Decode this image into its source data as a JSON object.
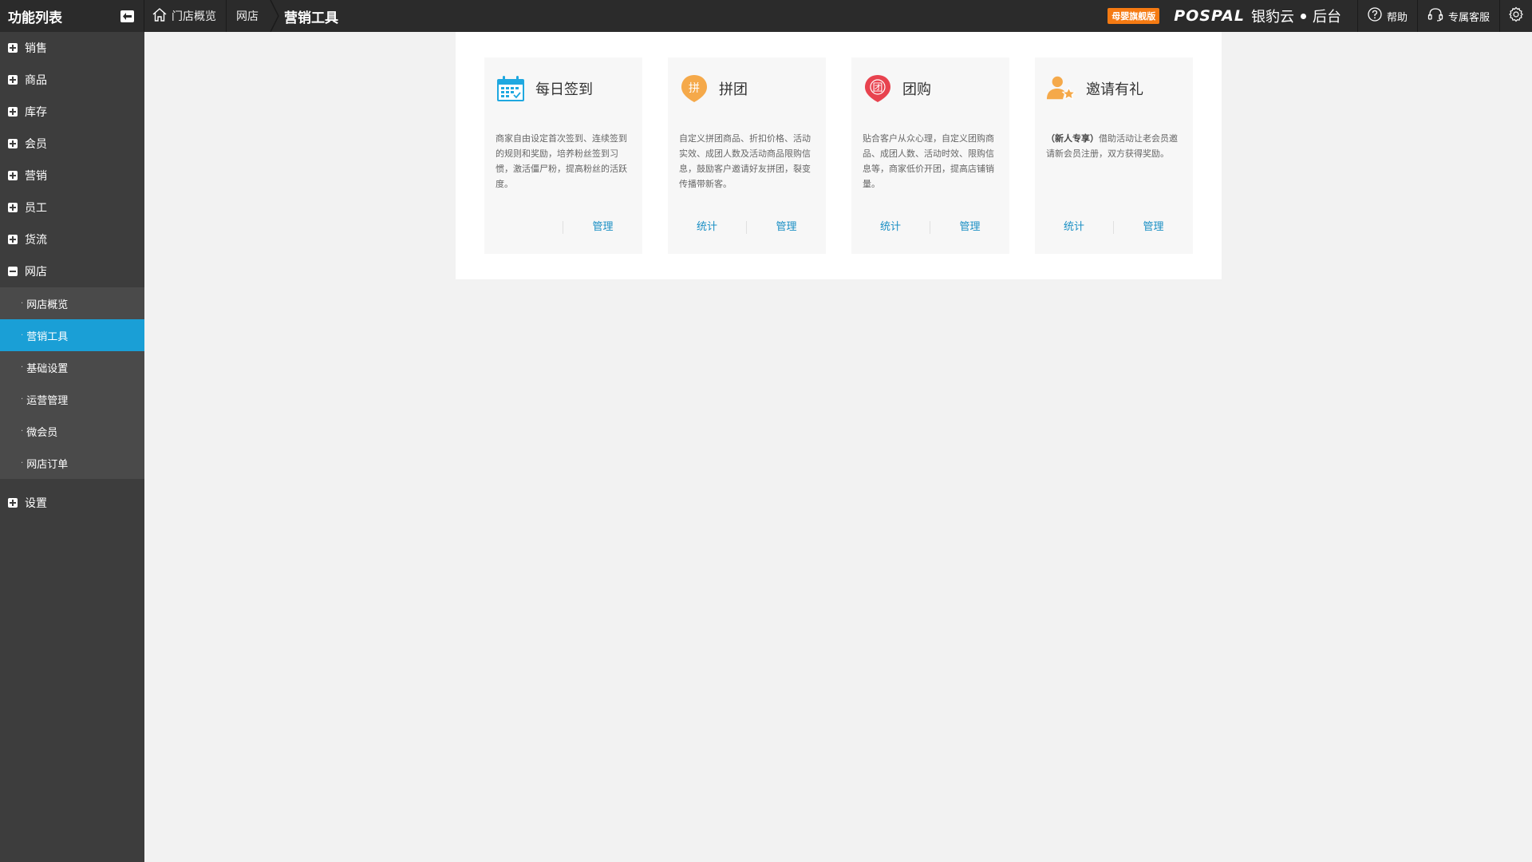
{
  "sidebar": {
    "title": "功能列表",
    "items": [
      {
        "label": "销售"
      },
      {
        "label": "商品"
      },
      {
        "label": "库存"
      },
      {
        "label": "会员"
      },
      {
        "label": "营销"
      },
      {
        "label": "员工"
      },
      {
        "label": "货流"
      },
      {
        "label": "网店"
      }
    ],
    "subitems": [
      {
        "label": "网店概览"
      },
      {
        "label": "营销工具"
      },
      {
        "label": "基础设置"
      },
      {
        "label": "运营管理"
      },
      {
        "label": "微会员"
      },
      {
        "label": "网店订单"
      }
    ],
    "settings_label": "设置",
    "active_subitem": "营销工具"
  },
  "breadcrumb": {
    "home": "门店概览",
    "section": "网店",
    "current": "营销工具"
  },
  "header": {
    "edition_badge": "母婴旗舰版",
    "logo_en": "POSPAL",
    "logo_cn": "银豹云",
    "logo_suffix": "后台",
    "help": "帮助",
    "support": "专属客服"
  },
  "cards": [
    {
      "title": "每日签到",
      "desc": "商家自由设定首次签到、连续签到的规则和奖励，培养粉丝签到习惯，激活僵尸粉，提高粉丝的活跃度。",
      "action_left": "",
      "action_right": "管理",
      "icon": "calendar-icon"
    },
    {
      "title": "拼团",
      "desc": "自定义拼团商品、折扣价格、活动实效、成团人数及活动商品限购信息，鼓励客户邀请好友拼团，裂变传播带新客。",
      "action_left": "统计",
      "action_right": "管理",
      "icon": "pin-icon",
      "icon_glyph": "拼"
    },
    {
      "title": "团购",
      "desc": "贴合客户从众心理，自定义团购商品、成团人数、活动时效、限购信息等，商家低价开团，提高店铺销量。",
      "action_left": "统计",
      "action_right": "管理",
      "icon": "group-buy-icon",
      "icon_glyph": "团"
    },
    {
      "title": "邀请有礼",
      "desc_bold": "（新人专享）",
      "desc": "借助活动让老会员邀请新会员注册，双方获得奖励。",
      "action_left": "统计",
      "action_right": "管理",
      "icon": "invite-icon"
    }
  ],
  "colors": {
    "topbar": "#2b2b2b",
    "sidebar": "#3d3d3d",
    "active": "#1a9fd6",
    "link": "#1a8fc4",
    "badge": "#f57a12"
  }
}
